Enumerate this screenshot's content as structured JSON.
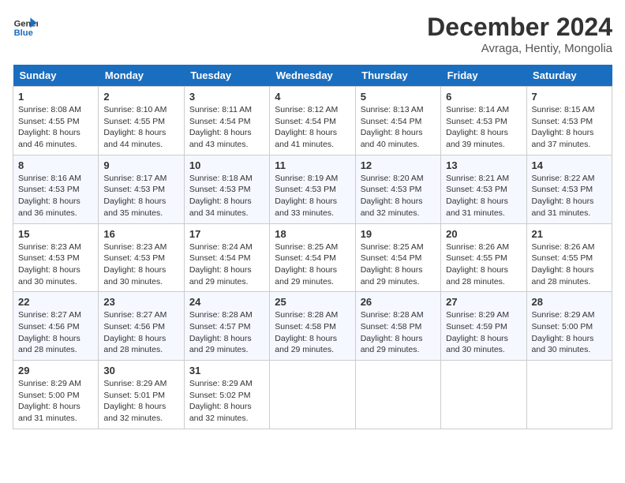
{
  "header": {
    "logo_line1": "General",
    "logo_line2": "Blue",
    "month_year": "December 2024",
    "location": "Avraga, Hentiy, Mongolia"
  },
  "days_of_week": [
    "Sunday",
    "Monday",
    "Tuesday",
    "Wednesday",
    "Thursday",
    "Friday",
    "Saturday"
  ],
  "weeks": [
    [
      {
        "day": "1",
        "sunrise": "8:08 AM",
        "sunset": "4:55 PM",
        "daylight": "8 hours and 46 minutes."
      },
      {
        "day": "2",
        "sunrise": "8:10 AM",
        "sunset": "4:55 PM",
        "daylight": "8 hours and 44 minutes."
      },
      {
        "day": "3",
        "sunrise": "8:11 AM",
        "sunset": "4:54 PM",
        "daylight": "8 hours and 43 minutes."
      },
      {
        "day": "4",
        "sunrise": "8:12 AM",
        "sunset": "4:54 PM",
        "daylight": "8 hours and 41 minutes."
      },
      {
        "day": "5",
        "sunrise": "8:13 AM",
        "sunset": "4:54 PM",
        "daylight": "8 hours and 40 minutes."
      },
      {
        "day": "6",
        "sunrise": "8:14 AM",
        "sunset": "4:53 PM",
        "daylight": "8 hours and 39 minutes."
      },
      {
        "day": "7",
        "sunrise": "8:15 AM",
        "sunset": "4:53 PM",
        "daylight": "8 hours and 37 minutes."
      }
    ],
    [
      {
        "day": "8",
        "sunrise": "8:16 AM",
        "sunset": "4:53 PM",
        "daylight": "8 hours and 36 minutes."
      },
      {
        "day": "9",
        "sunrise": "8:17 AM",
        "sunset": "4:53 PM",
        "daylight": "8 hours and 35 minutes."
      },
      {
        "day": "10",
        "sunrise": "8:18 AM",
        "sunset": "4:53 PM",
        "daylight": "8 hours and 34 minutes."
      },
      {
        "day": "11",
        "sunrise": "8:19 AM",
        "sunset": "4:53 PM",
        "daylight": "8 hours and 33 minutes."
      },
      {
        "day": "12",
        "sunrise": "8:20 AM",
        "sunset": "4:53 PM",
        "daylight": "8 hours and 32 minutes."
      },
      {
        "day": "13",
        "sunrise": "8:21 AM",
        "sunset": "4:53 PM",
        "daylight": "8 hours and 31 minutes."
      },
      {
        "day": "14",
        "sunrise": "8:22 AM",
        "sunset": "4:53 PM",
        "daylight": "8 hours and 31 minutes."
      }
    ],
    [
      {
        "day": "15",
        "sunrise": "8:23 AM",
        "sunset": "4:53 PM",
        "daylight": "8 hours and 30 minutes."
      },
      {
        "day": "16",
        "sunrise": "8:23 AM",
        "sunset": "4:53 PM",
        "daylight": "8 hours and 30 minutes."
      },
      {
        "day": "17",
        "sunrise": "8:24 AM",
        "sunset": "4:54 PM",
        "daylight": "8 hours and 29 minutes."
      },
      {
        "day": "18",
        "sunrise": "8:25 AM",
        "sunset": "4:54 PM",
        "daylight": "8 hours and 29 minutes."
      },
      {
        "day": "19",
        "sunrise": "8:25 AM",
        "sunset": "4:54 PM",
        "daylight": "8 hours and 29 minutes."
      },
      {
        "day": "20",
        "sunrise": "8:26 AM",
        "sunset": "4:55 PM",
        "daylight": "8 hours and 28 minutes."
      },
      {
        "day": "21",
        "sunrise": "8:26 AM",
        "sunset": "4:55 PM",
        "daylight": "8 hours and 28 minutes."
      }
    ],
    [
      {
        "day": "22",
        "sunrise": "8:27 AM",
        "sunset": "4:56 PM",
        "daylight": "8 hours and 28 minutes."
      },
      {
        "day": "23",
        "sunrise": "8:27 AM",
        "sunset": "4:56 PM",
        "daylight": "8 hours and 28 minutes."
      },
      {
        "day": "24",
        "sunrise": "8:28 AM",
        "sunset": "4:57 PM",
        "daylight": "8 hours and 29 minutes."
      },
      {
        "day": "25",
        "sunrise": "8:28 AM",
        "sunset": "4:58 PM",
        "daylight": "8 hours and 29 minutes."
      },
      {
        "day": "26",
        "sunrise": "8:28 AM",
        "sunset": "4:58 PM",
        "daylight": "8 hours and 29 minutes."
      },
      {
        "day": "27",
        "sunrise": "8:29 AM",
        "sunset": "4:59 PM",
        "daylight": "8 hours and 30 minutes."
      },
      {
        "day": "28",
        "sunrise": "8:29 AM",
        "sunset": "5:00 PM",
        "daylight": "8 hours and 30 minutes."
      }
    ],
    [
      {
        "day": "29",
        "sunrise": "8:29 AM",
        "sunset": "5:00 PM",
        "daylight": "8 hours and 31 minutes."
      },
      {
        "day": "30",
        "sunrise": "8:29 AM",
        "sunset": "5:01 PM",
        "daylight": "8 hours and 32 minutes."
      },
      {
        "day": "31",
        "sunrise": "8:29 AM",
        "sunset": "5:02 PM",
        "daylight": "8 hours and 32 minutes."
      },
      null,
      null,
      null,
      null
    ]
  ],
  "labels": {
    "sunrise": "Sunrise:",
    "sunset": "Sunset:",
    "daylight": "Daylight:"
  }
}
